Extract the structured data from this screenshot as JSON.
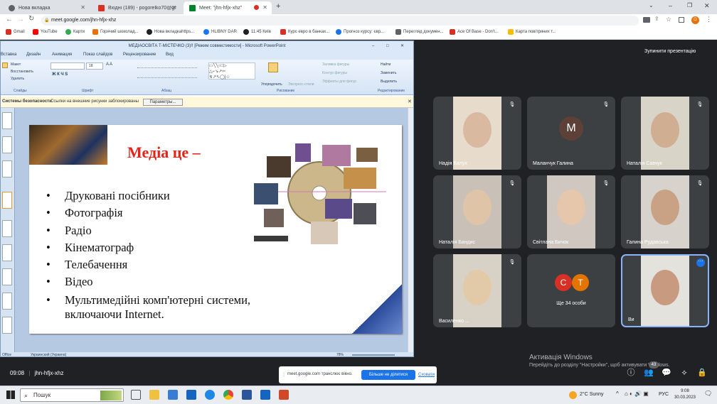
{
  "browser": {
    "tabs": [
      {
        "title": "Нова вкладка",
        "color": "#5f6368"
      },
      {
        "title": "Вхідні (189) - pogorelko70@gmail.com",
        "color": "#d93025"
      },
      {
        "title": "Meet: \"jhn-hfjx-xhz\"",
        "color": "#00832d"
      }
    ],
    "url": "meet.google.com/jhn-hfjx-xhz",
    "bookmarks": [
      "Gmail",
      "YouTube",
      "Карти",
      "Горячий шоколад...",
      "Нова вкладкаhttps...",
      "HLIBNY DAR",
      "11:45 Київ",
      "Курс евро в банках...",
      "Прогноз курсу: євр...",
      "Перегляд докумен...",
      "Ace Of Base - Don't...",
      "Карта повітряних т..."
    ]
  },
  "meet": {
    "stop_presenting": "Зупинити презентацію",
    "meeting_time": "09:08",
    "meeting_code": "jhn-hfjx-xhz",
    "people_count": "43",
    "share_notice": {
      "text": "meet.google.com транслює вікно.",
      "button": "Більше не ділитися",
      "cancel": "Сховати"
    },
    "activation_title": "Активація Windows",
    "activation_text": "Перейдіть до розділу \"Настройки\", щоб активувати Windows.",
    "more_people": "Ще 34 особи"
  },
  "participants": [
    {
      "name": "Надія Балух",
      "skin": "#d9b9a0",
      "bg": "#e7dccb"
    },
    {
      "name": "Маланчук Галина",
      "initial": "M",
      "avatar_color": "#5d4037"
    },
    {
      "name": "Наталія Савчук",
      "skin": "#cfae92",
      "bg": "#d9d4c8"
    },
    {
      "name": "Наталія Бандис",
      "skin": "#e0c4a8",
      "bg": "#c9c1b8"
    },
    {
      "name": "Світлана Бичок",
      "skin": "#e6c7ab",
      "bg": "#cfc7c0"
    },
    {
      "name": "Галина Рудавська",
      "skin": "#c9a286",
      "bg": "#d7d3cc"
    },
    {
      "name": "Василенко ...",
      "skin": "#e2caa9",
      "bg": "#d8d2c6"
    },
    {
      "name": "Ви",
      "skin": "#c89a80",
      "bg": "#e4e2dd"
    }
  ],
  "more_avatars": [
    {
      "letter": "С",
      "color": "#d93025"
    },
    {
      "letter": "Т",
      "color": "#e37400"
    }
  ],
  "ppt": {
    "title": "МЕДІАОСВІТА Т-МІСТЕЧКО (3)!! [Режим совместимости] - Microsoft PowerPoint",
    "menu": [
      "Вставка",
      "Дизайн",
      "Анимация",
      "Показ слайдов",
      "Рецензирование",
      "Вид"
    ],
    "ribbon_groups": [
      "Слайды",
      "Шрифт",
      "Абзац",
      "Рисование",
      "Редактирование"
    ],
    "ribbon_items": [
      "Макет",
      "Восстановить",
      "Удалить",
      "Упорядочить",
      "Экспресс-стили",
      "Заливка фигуры",
      "Контур фигуры",
      "Эффекты для фигур",
      "Найти",
      "Заменить",
      "Выделить"
    ],
    "font_size": "18",
    "security_text": "Системы безопасности",
    "security_msg": "Ссылки на внешние рисунки заблокированы",
    "params_button": "Параметры...",
    "status_lang": "Украинский (Украина)",
    "status_theme": "Office",
    "zoom": "78%"
  },
  "slide": {
    "title": "Медіа це –",
    "bullets": [
      "Друковані посібники",
      "Фотографія",
      "Радіо",
      "Кінематограф",
      "Телебачення",
      "Відео",
      "Мультимедійні комп'ютерні системи, включаючи Internet."
    ]
  },
  "taskbar": {
    "search_placeholder": "Пошук",
    "weather": "2°C  Sunny",
    "lang": "РУС",
    "time": "9:08",
    "date": "30.03.2023"
  }
}
